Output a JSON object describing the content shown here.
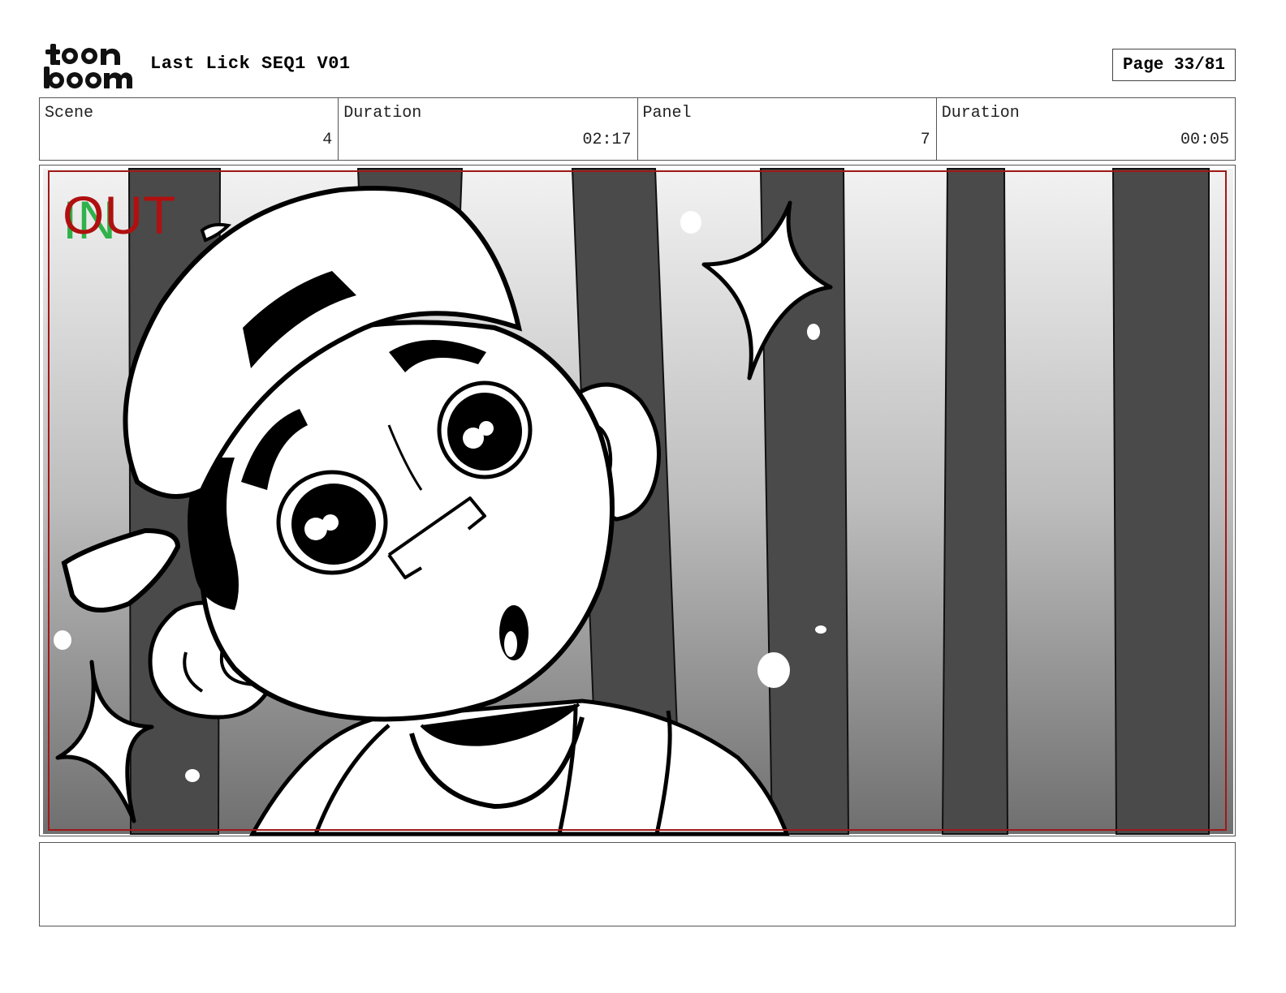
{
  "header": {
    "title": "Last Lick SEQ1 V01",
    "page_label": "Page 33/81",
    "logo_alt": "toon boom"
  },
  "info": {
    "scene_label": "Scene",
    "scene_value": "4",
    "scene_duration_label": "Duration",
    "scene_duration_value": "02:17",
    "panel_label": "Panel",
    "panel_value": "7",
    "panel_duration_label": "Duration",
    "panel_duration_value": "00:05"
  },
  "panel": {
    "in_marker": "IN",
    "out_marker": "OUT",
    "in_color": "#2fb24a",
    "out_color": "#b01010",
    "safe_frame_color": "#a01818"
  },
  "notes": {
    "text": ""
  }
}
